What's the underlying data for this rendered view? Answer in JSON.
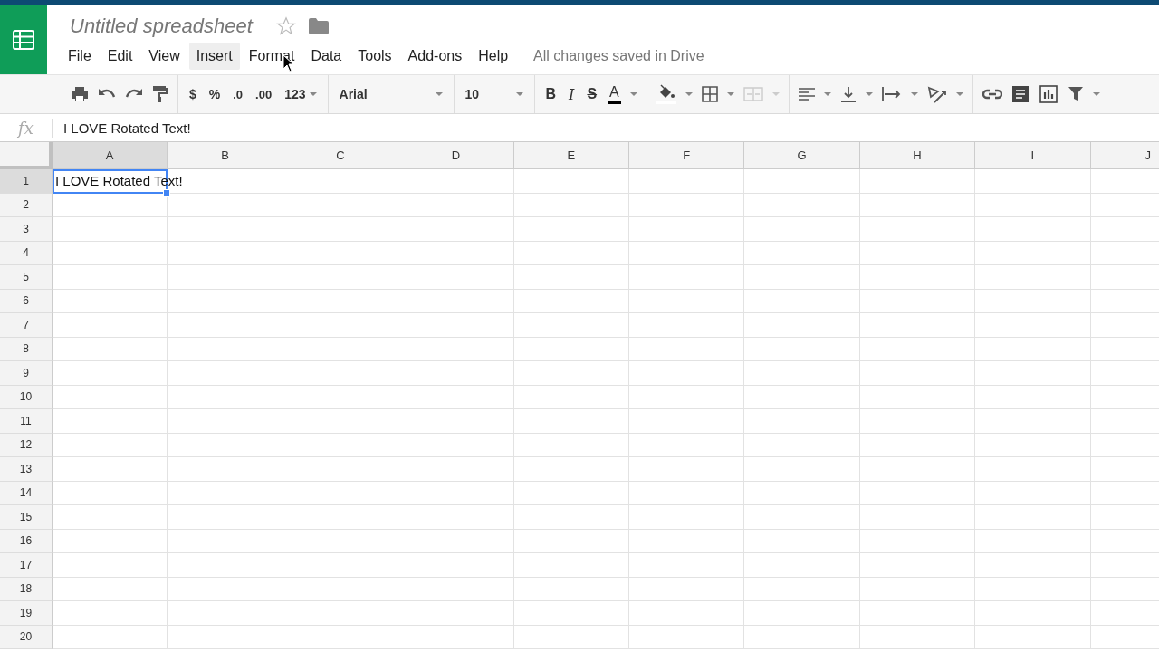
{
  "document": {
    "title": "Untitled spreadsheet",
    "starred": false
  },
  "menu": [
    {
      "label": "File",
      "hovered": false
    },
    {
      "label": "Edit",
      "hovered": false
    },
    {
      "label": "View",
      "hovered": false
    },
    {
      "label": "Insert",
      "hovered": true
    },
    {
      "label": "Format",
      "hovered": false
    },
    {
      "label": "Data",
      "hovered": false
    },
    {
      "label": "Tools",
      "hovered": false
    },
    {
      "label": "Add-ons",
      "hovered": false
    },
    {
      "label": "Help",
      "hovered": false
    }
  ],
  "save_status": "All changes saved in Drive",
  "toolbar": {
    "currency": "$",
    "percent": "%",
    "decrease_decimals": ".0",
    "increase_decimals": ".00",
    "number_format": "123",
    "font": "Arial",
    "font_size": "10",
    "bold": "B",
    "italic": "I",
    "strikethrough": "S",
    "text_color": "A"
  },
  "formula_bar": {
    "icon_text": "fx",
    "value": "I LOVE Rotated Text!"
  },
  "columns": [
    {
      "label": "A",
      "selected": true
    },
    {
      "label": "B",
      "selected": false
    },
    {
      "label": "C",
      "selected": false
    },
    {
      "label": "D",
      "selected": false
    },
    {
      "label": "E",
      "selected": false
    },
    {
      "label": "F",
      "selected": false
    },
    {
      "label": "G",
      "selected": false
    },
    {
      "label": "H",
      "selected": false
    },
    {
      "label": "I",
      "selected": false
    },
    {
      "label": "J",
      "selected": false
    }
  ],
  "rows": [
    {
      "label": "1",
      "selected": true,
      "cells": [
        "I LOVE Rotated Text!"
      ]
    },
    {
      "label": "2",
      "selected": false
    },
    {
      "label": "3",
      "selected": false
    },
    {
      "label": "4",
      "selected": false
    },
    {
      "label": "5",
      "selected": false
    },
    {
      "label": "6",
      "selected": false
    },
    {
      "label": "7",
      "selected": false
    },
    {
      "label": "8",
      "selected": false
    },
    {
      "label": "9",
      "selected": false
    },
    {
      "label": "10",
      "selected": false
    },
    {
      "label": "11",
      "selected": false
    },
    {
      "label": "12",
      "selected": false
    },
    {
      "label": "13",
      "selected": false
    },
    {
      "label": "14",
      "selected": false
    },
    {
      "label": "15",
      "selected": false
    },
    {
      "label": "16",
      "selected": false
    },
    {
      "label": "17",
      "selected": false
    },
    {
      "label": "18",
      "selected": false
    },
    {
      "label": "19",
      "selected": false
    },
    {
      "label": "20",
      "selected": false
    }
  ]
}
